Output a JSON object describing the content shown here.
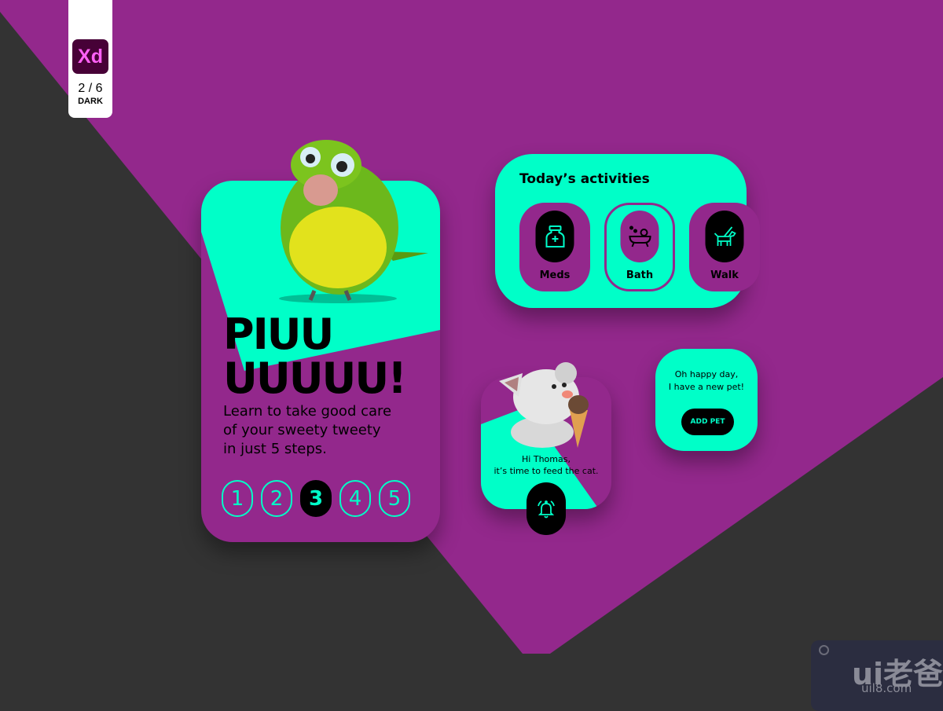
{
  "colors": {
    "purple": "#93288c",
    "teal": "#00ffc8",
    "dark": "#333333",
    "black": "#000000"
  },
  "badge": {
    "app": "Xd",
    "page": "2 / 6",
    "mode": "DARK"
  },
  "onboarding": {
    "title_line1": "PIUU",
    "title_line2": "UUUUU!",
    "description": [
      "Learn to take good care",
      "of your sweety tweety",
      "in just 5 steps."
    ],
    "steps": [
      "1",
      "2",
      "3",
      "4",
      "5"
    ],
    "active_step": 3
  },
  "activities": {
    "title": "Today’s activities",
    "items": [
      {
        "label": "Meds",
        "icon": "medicine-bottle-icon",
        "selected": false
      },
      {
        "label": "Bath",
        "icon": "bathtub-icon",
        "selected": true
      },
      {
        "label": "Walk",
        "icon": "dog-walk-icon",
        "selected": false
      }
    ]
  },
  "reminder": {
    "line1": "Hi Thomas,",
    "line2": "it’s time to feed the cat.",
    "icon": "bell-icon"
  },
  "new_pet": {
    "line1": "Oh happy day,",
    "line2": "I have a new pet!",
    "button": "ADD PET"
  },
  "watermark": {
    "logo": "ui老爸",
    "url": "uil8.com"
  }
}
